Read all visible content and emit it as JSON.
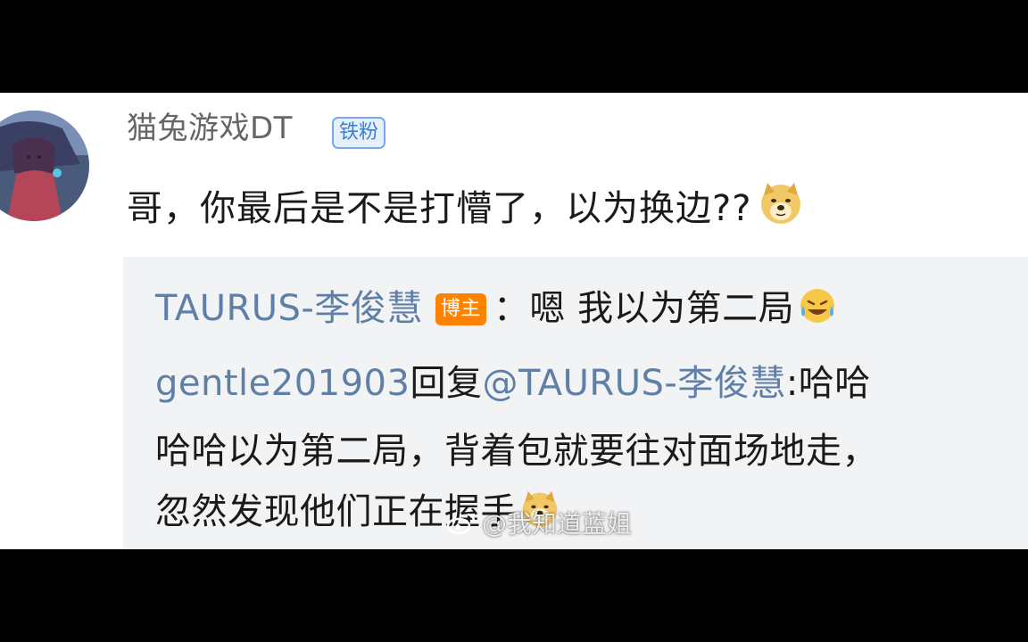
{
  "comment": {
    "username": "猫兔游戏DT",
    "fan_badge": "铁粉",
    "text": "哥，你最后是不是打懵了，以为换边??",
    "emoji": "doge-emoji"
  },
  "replies": [
    {
      "author": "TAURUS-李俊慧",
      "badge": "博主",
      "text": "：嗯 我以为第二局",
      "emoji": "laugh-cry-emoji"
    },
    {
      "author": "gentle201903",
      "reply_word": "回复",
      "mention": "@TAURUS-李俊慧",
      "text_line1": ":哈哈",
      "text_line2": "哈哈以为第二局，背着包就要往对面场地走，",
      "text_line3": "忽然发现他们正在握手",
      "emoji": "doge-emoji"
    }
  ],
  "watermark": {
    "text": "@我知道蓝姐",
    "logo": "weibo-logo-icon"
  },
  "colors": {
    "link": "#5f7fa6",
    "badge_fan_bg": "#e6f0fd",
    "badge_blogger_bg": "#ff8200",
    "reply_bg": "#f2f3f5"
  }
}
